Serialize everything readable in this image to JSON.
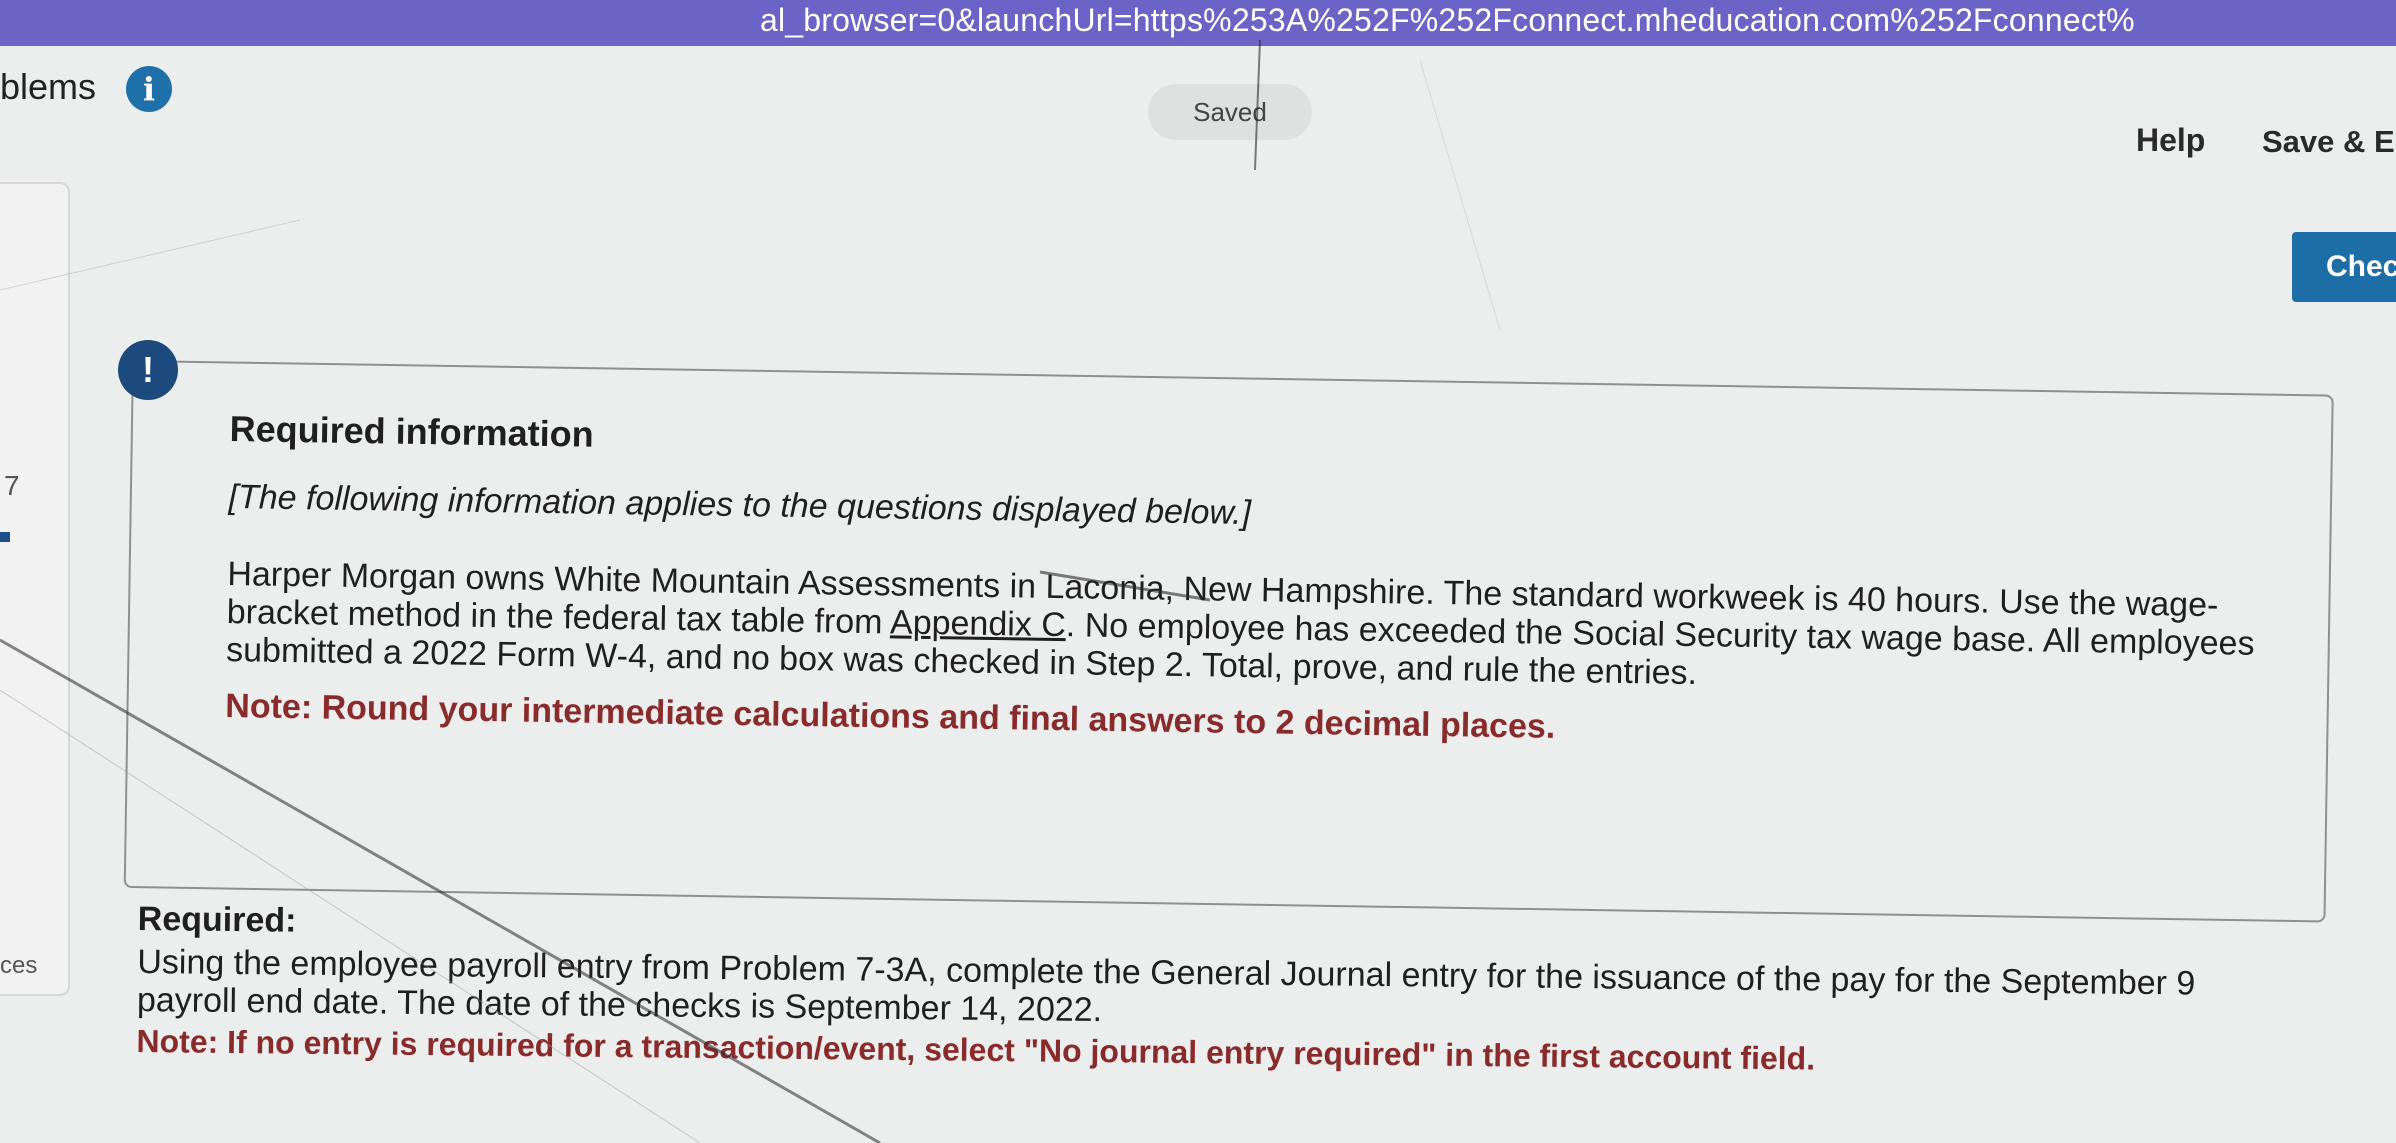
{
  "browser": {
    "url_fragment": "al_browser=0&launchUrl=https%253A%252F%252Fconnect.mheducation.com%252Fconnect%"
  },
  "header": {
    "title_fragment": "blems",
    "saved_label": "Saved",
    "help_label": "Help",
    "save_exit_label": "Save & E",
    "check_label": "Chec"
  },
  "sidebar": {
    "question_number": "7",
    "resources_fragment": "ces"
  },
  "info": {
    "heading": "Required information",
    "applies_note": "[The following information applies to the questions displayed below.]",
    "problem_before_link": "Harper Morgan owns White Mountain Assessments in Laconia, New Hampshire. The standard workweek is 40 hours. Use the wage-bracket method in the federal tax table from ",
    "appendix_link": "Appendix C",
    "problem_after_link": ". No employee has exceeded the Social Security tax wage base. All employees submitted a 2022 Form W-4, and no box was checked in Step 2. Total, prove, and rule the entries.",
    "note": "Note: Round your intermediate calculations and final answers to 2 decimal places."
  },
  "required": {
    "label": "Required:",
    "text": "Using the employee payroll entry from Problem 7-3A, complete the General Journal entry for the issuance of the pay for the September 9 payroll end date. The date of the checks is September 14, 2022.",
    "note": "Note: If no entry is required for a transaction/event, select \"No journal entry required\" in the first account field."
  },
  "colors": {
    "url_bar": "#6c63c6",
    "primary_blue": "#1d6ea6",
    "alert_navy": "#1c4a7c",
    "note_red": "#8a2b2b"
  }
}
